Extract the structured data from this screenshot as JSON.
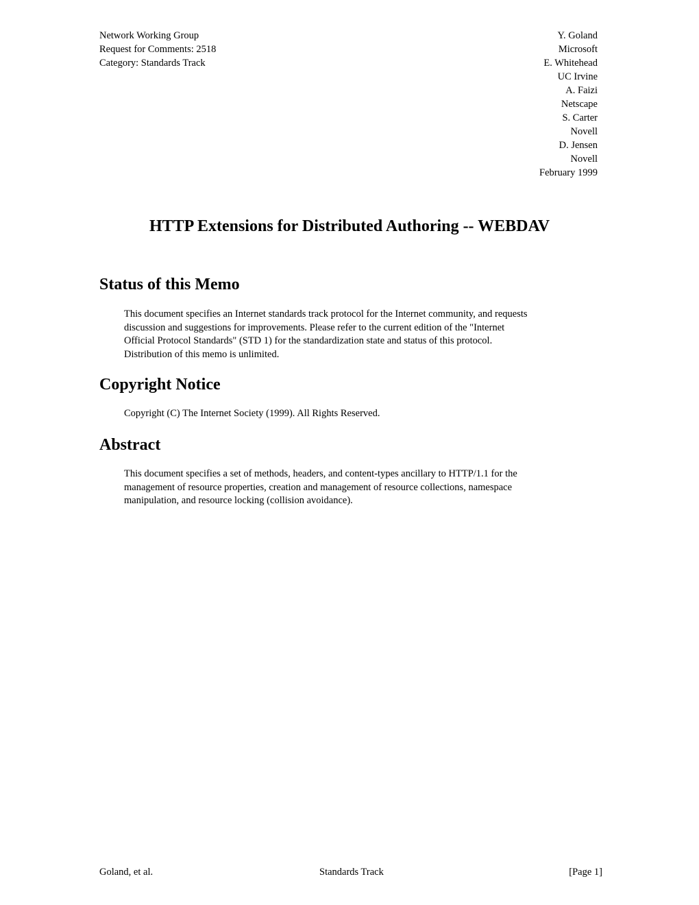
{
  "header": {
    "left": [
      "Network Working Group",
      "Request for Comments: 2518",
      "Category: Standards Track"
    ],
    "right": [
      "Y. Goland",
      "Microsoft",
      "E. Whitehead",
      "UC Irvine",
      "A. Faizi",
      "Netscape",
      "S. Carter",
      "Novell",
      "D. Jensen",
      "Novell",
      "February 1999"
    ]
  },
  "title": "HTTP Extensions for Distributed Authoring -- WEBDAV",
  "sections": [
    {
      "heading": "Status of this Memo",
      "lines": [
        "This document specifies an Internet standards track protocol for the Internet community, and requests",
        "discussion and suggestions for improvements.  Please refer to the current edition of the \"Internet",
        "Official Protocol Standards\" (STD 1) for the standardization state and status of this protocol.",
        "Distribution of this memo is unlimited."
      ]
    },
    {
      "heading": "Copyright Notice",
      "lines": [
        "Copyright (C) The Internet Society (1999). All Rights Reserved."
      ]
    },
    {
      "heading": "Abstract",
      "lines": [
        "This document specifies a set of methods, headers, and content-types ancillary to HTTP/1.1 for the",
        "management of resource properties, creation and management of resource collections, namespace",
        "manipulation, and resource locking (collision avoidance)."
      ]
    }
  ],
  "footer": {
    "left": "Goland, et al.",
    "center": "Standards Track",
    "right": "[Page 1]"
  }
}
